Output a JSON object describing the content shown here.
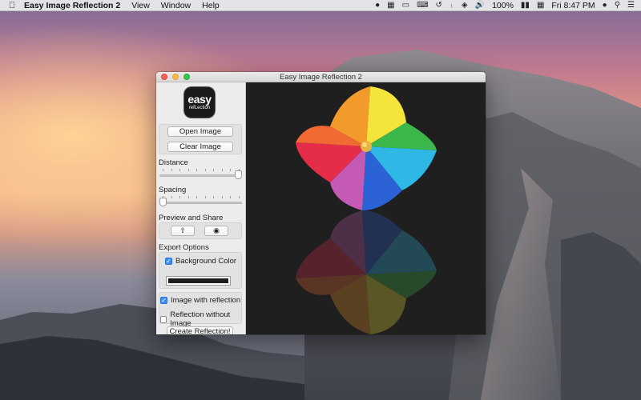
{
  "menubar": {
    "app_name": "Easy Image Reflection 2",
    "menus": [
      "View",
      "Window",
      "Help"
    ],
    "battery": "100%",
    "clock": "Fri 8:47 PM"
  },
  "window": {
    "title": "Easy Image Reflection 2",
    "logo_line1": "easy",
    "logo_line2": "refLection"
  },
  "sidebar": {
    "open_image": "Open Image",
    "clear_image": "Clear Image",
    "distance_label": "Distance",
    "distance_value": 1.0,
    "spacing_label": "Spacing",
    "spacing_value": 0.0,
    "preview_share_label": "Preview and Share",
    "export_label": "Export Options",
    "background_color_label": "Background Color",
    "background_color_checked": true,
    "background_color": "#1c1c1c",
    "image_with_reflection": "Image with reflection",
    "image_with_reflection_checked": true,
    "reflection_without_image": "Reflection without Image",
    "reflection_without_image_checked": false,
    "create_button": "Create Reflection!"
  },
  "colors": {
    "accent": "#3d8ff5",
    "preview_bg": "#1f1f1f"
  }
}
